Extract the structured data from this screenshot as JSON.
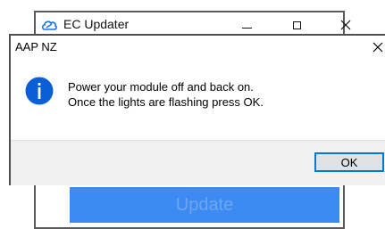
{
  "background_window": {
    "app_icon": "cloud-link-icon",
    "title": "EC Updater",
    "controls": {
      "minimize_icon": "minimize-icon",
      "maximize_icon": "maximize-icon",
      "close_icon": "close-icon"
    },
    "update_button_label": "Update",
    "accent_color": "#3c8bf2"
  },
  "dialog": {
    "title": "AAP NZ",
    "close_icon": "close-icon",
    "icon": "info-icon",
    "icon_color": "#0a5fd6",
    "message_lines": [
      "Power your module off and back on.",
      "Once the lights are flashing press OK."
    ],
    "ok_button_label": "OK"
  }
}
